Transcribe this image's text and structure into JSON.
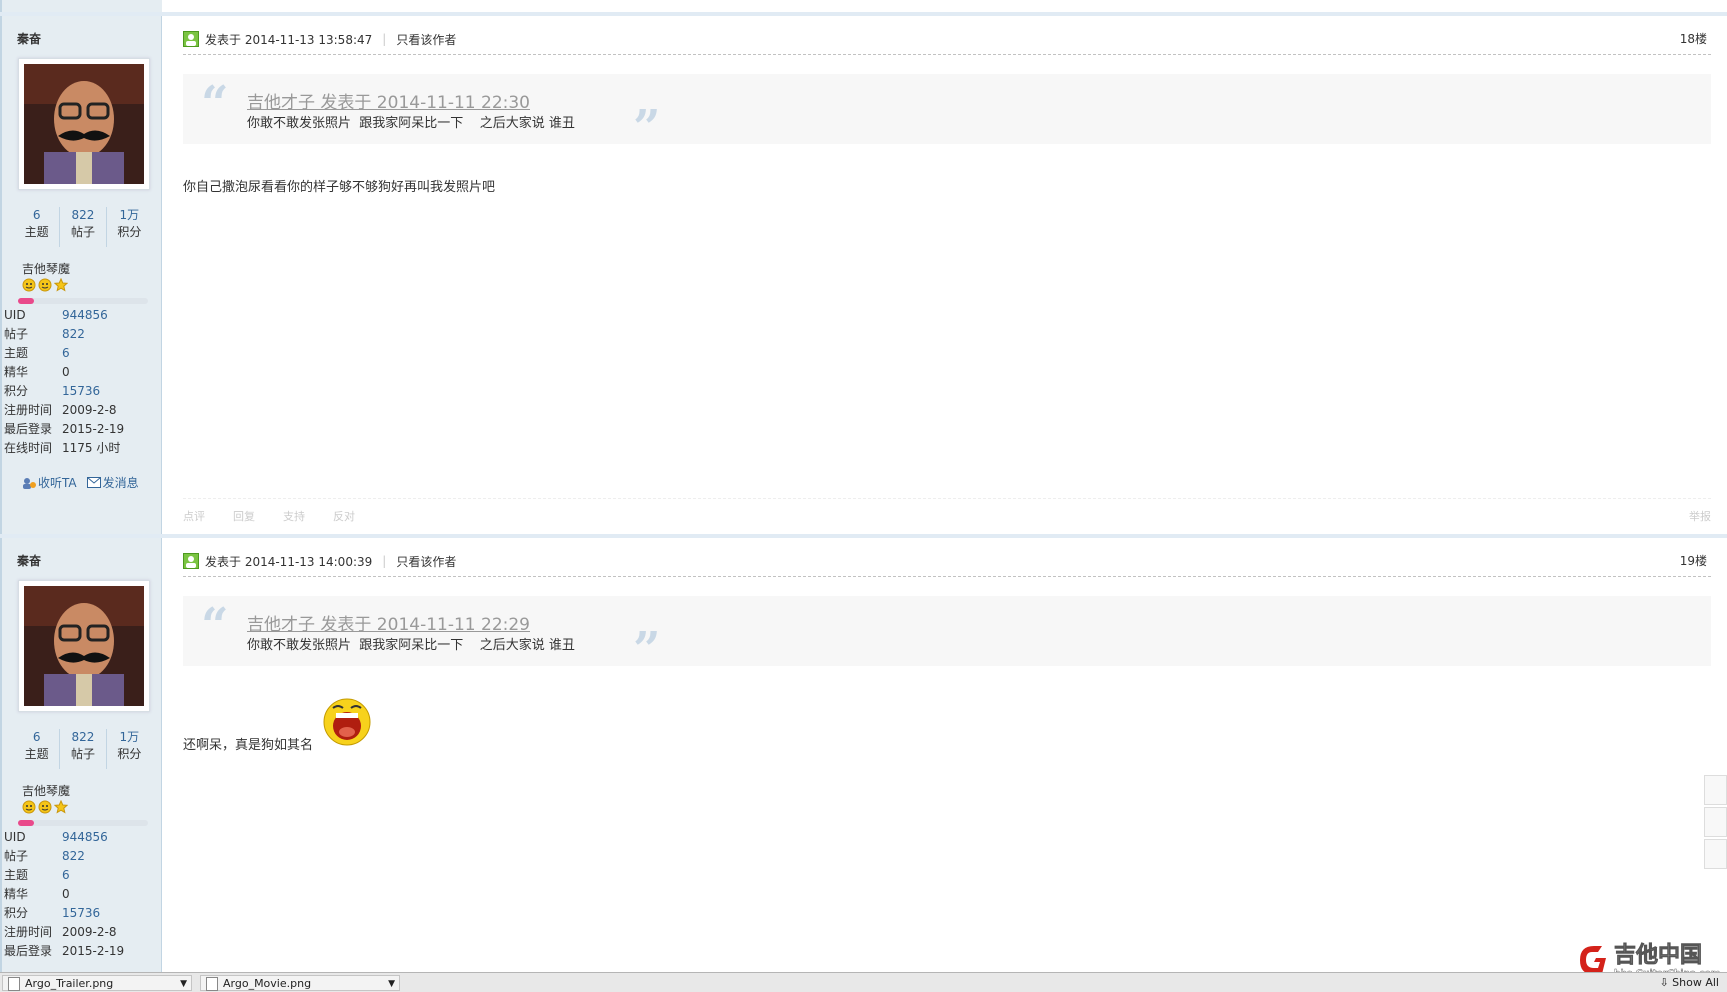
{
  "posts": [
    {
      "author": "秦奋",
      "stats": [
        {
          "num": "6",
          "label": "主题"
        },
        {
          "num": "822",
          "label": "帖子"
        },
        {
          "num": "1万",
          "label": "积分"
        }
      ],
      "group": "吉他琴魔",
      "level_progress": 0.12,
      "info": [
        {
          "k": "UID",
          "v": "944856"
        },
        {
          "k": "帖子",
          "v": "822"
        },
        {
          "k": "主题",
          "v": "6"
        },
        {
          "k": "精华",
          "v": "0"
        },
        {
          "k": "积分",
          "v": "15736"
        },
        {
          "k": "注册时间",
          "v": "2009-2-8"
        },
        {
          "k": "最后登录",
          "v": "2015-2-19"
        },
        {
          "k": "在线时间",
          "v": "1175 小时"
        }
      ],
      "follow_label": "收听TA",
      "message_label": "发消息",
      "posted_at": "发表于 2014-11-13 13:58:47",
      "only_author": "只看该作者",
      "floor": "18楼",
      "quote_cite": "吉他才子 发表于 2014-11-11 22:30",
      "quote_text": "你敢不敢发张照片  跟我家阿呆比一下    之后大家说 谁丑",
      "body": "你自己撒泡尿看看你的样子够不够狗好再叫我发照片吧",
      "footer": [
        "点评",
        "回复",
        "支持",
        "反对"
      ],
      "report": "举报"
    },
    {
      "author": "秦奋",
      "stats": [
        {
          "num": "6",
          "label": "主题"
        },
        {
          "num": "822",
          "label": "帖子"
        },
        {
          "num": "1万",
          "label": "积分"
        }
      ],
      "group": "吉他琴魔",
      "level_progress": 0.12,
      "info": [
        {
          "k": "UID",
          "v": "944856"
        },
        {
          "k": "帖子",
          "v": "822"
        },
        {
          "k": "主题",
          "v": "6"
        },
        {
          "k": "精华",
          "v": "0"
        },
        {
          "k": "积分",
          "v": "15736"
        },
        {
          "k": "注册时间",
          "v": "2009-2-8"
        },
        {
          "k": "最后登录",
          "v": "2015-2-19"
        }
      ],
      "posted_at": "发表于 2014-11-13 14:00:39",
      "only_author": "只看该作者",
      "floor": "19楼",
      "quote_cite": "吉他才子 发表于 2014-11-11 22:29",
      "quote_text": "你敢不敢发张照片  跟我家阿呆比一下    之后大家说 谁丑",
      "body": "还啊呆，真是狗如其名"
    }
  ],
  "downloads": [
    {
      "name": "Argo_Trailer.png"
    },
    {
      "name": "Argo_Movie.png"
    }
  ],
  "show_all": "Show All",
  "watermark": {
    "line1": "吉他中国",
    "line2": "bbs.GuitarChina.com"
  },
  "colors": {
    "sidebar_bg": "#e5edf2",
    "link": "#336699",
    "progress": "#e94a8b",
    "quote_bg": "#f7f7f7"
  }
}
